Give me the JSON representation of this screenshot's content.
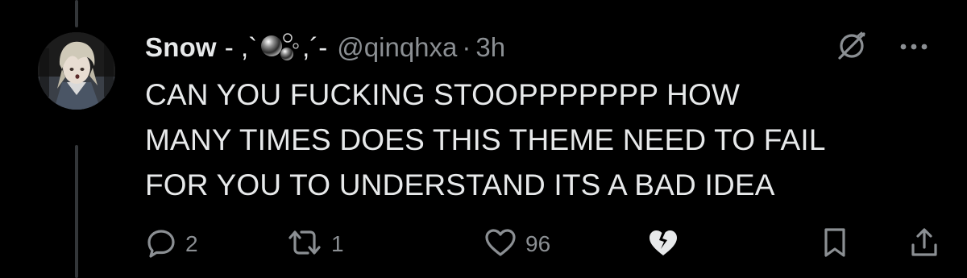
{
  "tweet": {
    "display_name": "Snow",
    "name_decor_left": "- ,`",
    "name_decor_right": ",´-",
    "handle": "@qinqhxa",
    "separator": "·",
    "time": "3h",
    "text_lines": [
      "CAN YOU FUCKING STOOPPPPPPP HOW",
      "MANY TIMES DOES THIS THEME NEED TO FAIL",
      "FOR YOU TO UNDERSTAND ITS A BAD IDEA"
    ]
  },
  "actions": {
    "replies": "2",
    "retweets": "1",
    "likes": "96"
  },
  "icons": {
    "reply": "reply-icon",
    "retweet": "retweet-icon",
    "like": "heart-icon",
    "heartbreak": "broken-heart-icon",
    "bookmark": "bookmark-icon",
    "share": "share-icon",
    "grok": "grok-icon",
    "more": "more-icon"
  },
  "colors": {
    "background": "#000000",
    "text": "#e7e9ea",
    "muted": "#8b8f93",
    "icon": "#71767b",
    "thread_line": "#333639"
  }
}
